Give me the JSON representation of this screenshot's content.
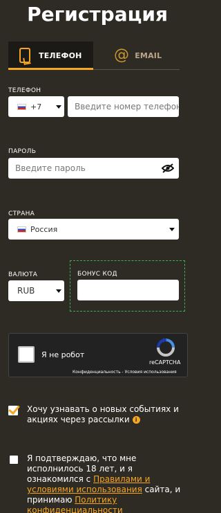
{
  "title": "Регистрация",
  "tabs": [
    {
      "label": "ТЕЛЕФОН",
      "icon": "phone-icon",
      "active": true
    },
    {
      "label": "EMAIL",
      "icon": "at-icon",
      "active": false
    }
  ],
  "phone": {
    "label": "ТЕЛЕФОН",
    "country_code": "+7",
    "placeholder": "Введите номер телефона"
  },
  "password": {
    "label": "ПАРОЛЬ",
    "placeholder": "Введите пароль"
  },
  "country": {
    "label": "СТРАНА",
    "value": "Россия"
  },
  "currency": {
    "label": "ВАЛЮТА",
    "value": "RUB"
  },
  "bonus": {
    "label": "БОНУС КОД",
    "value": ""
  },
  "captcha": {
    "label": "Я не робот",
    "brand": "reCAPTCHA",
    "links": "Конфиденциальность - Условия использования"
  },
  "newsletter": {
    "checked": true,
    "text": "Хочу узнавать о новых событиях и акциях через рассылки"
  },
  "terms": {
    "checked": false,
    "text_before": "Я подтверждаю, что мне исполнилось 18 лет, и я ознакомился с ",
    "rules_link": "Правилами и условиями использования",
    "text_middle": " сайта, и принимаю ",
    "privacy_link": "Политику конфиденциальности"
  },
  "colors": {
    "background": "#2e2a24",
    "accent": "#f5a623",
    "bonus_border": "#3fae5a"
  }
}
